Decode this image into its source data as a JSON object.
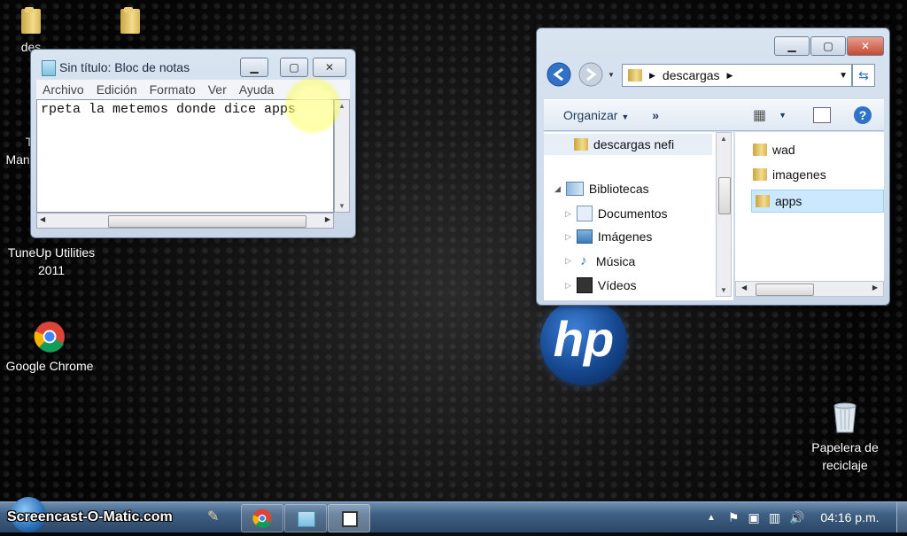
{
  "desktop": {
    "icons": [
      {
        "label": "des"
      },
      {
        "label": ""
      },
      {
        "label": "T"
      },
      {
        "label": "Mant"
      },
      {
        "label": "TuneUp Utilities 2011"
      },
      {
        "label": "Google Chrome"
      },
      {
        "label": "Papelera de reciclaje"
      }
    ]
  },
  "notepad": {
    "title": "Sin título: Bloc de notas",
    "menu": [
      "Archivo",
      "Edición",
      "Formato",
      "Ver",
      "Ayuda"
    ],
    "text": "rpeta la metemos donde dice apps"
  },
  "explorer": {
    "breadcrumb_current": "descargas",
    "toolbar": {
      "organize_label": "Organizar",
      "more_label": "»"
    },
    "nav": {
      "favorite": "descargas nefi",
      "library_header": "Bibliotecas",
      "libraries": [
        "Documentos",
        "Imágenes",
        "Música",
        "Vídeos"
      ]
    },
    "folders": [
      "wad",
      "imagenes",
      "apps"
    ],
    "selected_folder": "apps"
  },
  "hp_logo": "hp",
  "taskbar": {
    "watermark": "Screencast-O-Matic.com",
    "clock": "04:16 p.m."
  },
  "colors": {
    "taskbar": "#3f5f82",
    "selection": "#cce8ff",
    "close": "#c44a34"
  }
}
